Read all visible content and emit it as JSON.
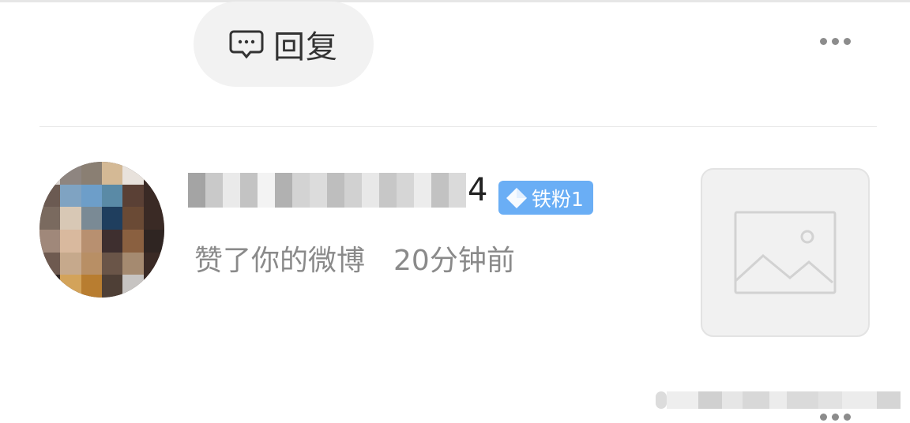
{
  "reply": {
    "label": "回复",
    "icon": "comment-icon"
  },
  "notification": {
    "username_visible_tail": "4",
    "fan_badge": {
      "label": "铁粉1",
      "icon": "diamond-icon",
      "color": "#6aaef5"
    },
    "action": "赞了你的微博",
    "time": "20分钟前",
    "thumbnail_icon": "image-placeholder-icon"
  },
  "colors": {
    "secondary_text": "#8a8a8a",
    "pill_background": "#f2f2f2",
    "divider": "#e8e8e8"
  }
}
